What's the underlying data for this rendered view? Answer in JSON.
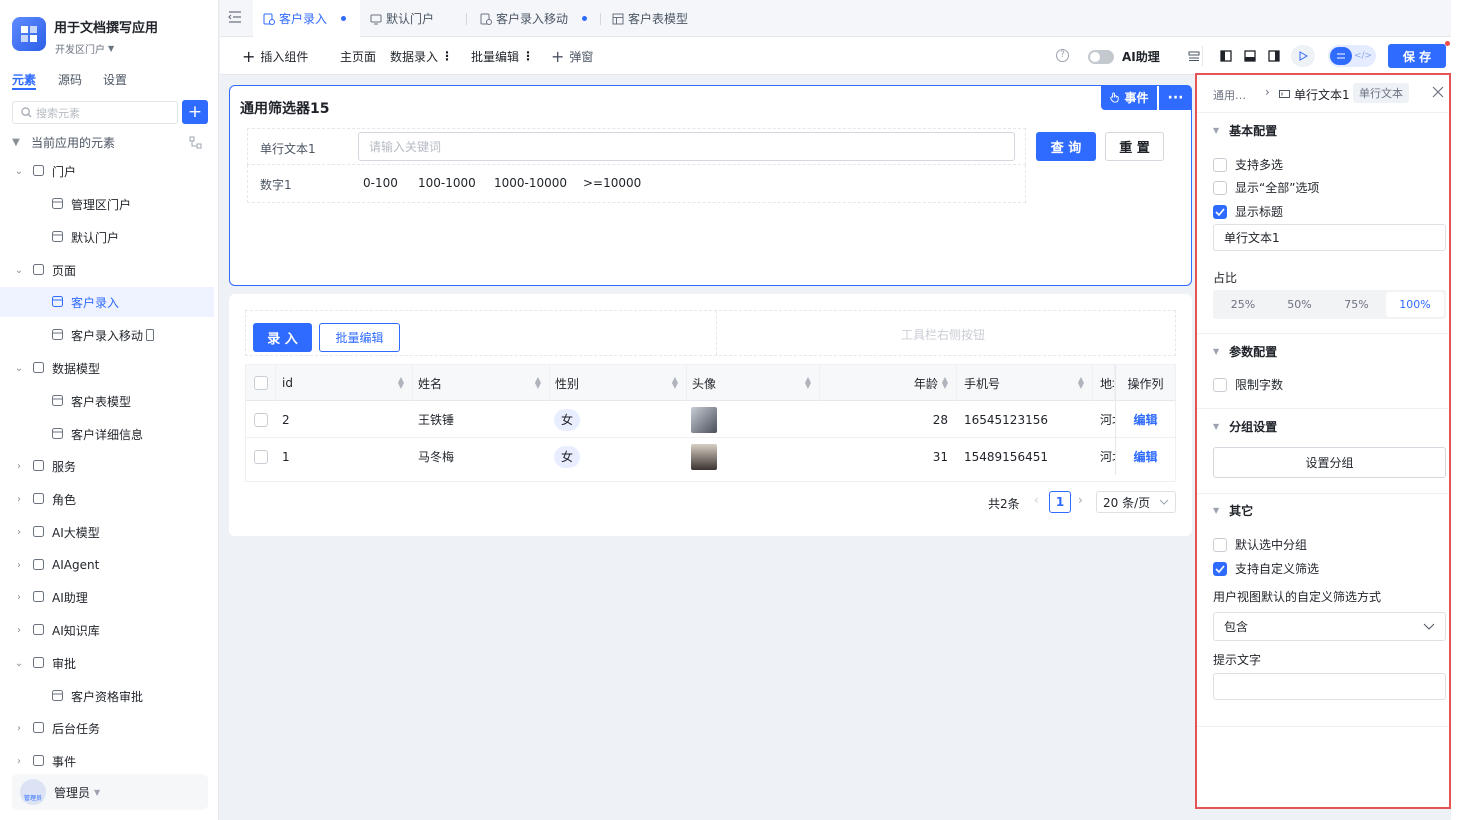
{
  "app": {
    "title": "用于文档撰写应用",
    "portal": "开发区门户"
  },
  "sidebar": {
    "tabs": [
      "元素",
      "源码",
      "设置"
    ],
    "search_placeholder": "搜索元素",
    "section": "当前应用的元素",
    "items": [
      {
        "label": "门户",
        "icon": "home-icon"
      },
      {
        "label": "管理区门户",
        "icon": "monitor-icon"
      },
      {
        "label": "默认门户",
        "icon": "monitor-icon"
      },
      {
        "label": "页面",
        "icon": "page-icon"
      },
      {
        "label": "客户录入",
        "icon": "page-globe-icon"
      },
      {
        "label": "客户录入移动",
        "icon": "page-globe-icon"
      },
      {
        "label": "数据模型",
        "icon": "table-icon"
      },
      {
        "label": "客户表模型",
        "icon": "table-icon"
      },
      {
        "label": "客户详细信息",
        "icon": "table-icon"
      },
      {
        "label": "服务",
        "icon": "service-icon"
      },
      {
        "label": "角色",
        "icon": "role-icon"
      },
      {
        "label": "AI大模型",
        "icon": "cube-icon"
      },
      {
        "label": "AIAgent",
        "icon": "robot-icon"
      },
      {
        "label": "AI助理",
        "icon": "ai-icon"
      },
      {
        "label": "AI知识库",
        "icon": "book-icon"
      },
      {
        "label": "审批",
        "icon": "stamp-icon"
      },
      {
        "label": "客户资格审批",
        "icon": "stamp-icon"
      },
      {
        "label": "后台任务",
        "icon": "task-icon"
      },
      {
        "label": "事件",
        "icon": "event-icon"
      }
    ],
    "user": "管理员",
    "avatar_text": "管理员"
  },
  "tabs": [
    "客户录入",
    "默认门户",
    "客户录入移动",
    "客户表模型"
  ],
  "toolbar": {
    "insert": "插入组件",
    "home": "主页面",
    "data_entry": "数据录入",
    "batch_edit": "批量编辑",
    "popup": "弹窗",
    "ai_assist": "AI助理",
    "save": "保 存"
  },
  "filter": {
    "title": "通用筛选器15",
    "event_btn": "事件",
    "text_label": "单行文本1",
    "text_placeholder": "请输入关键词",
    "query": "查 询",
    "reset": "重 置",
    "num_label": "数字1",
    "num_options": [
      "0-100",
      "100-1000",
      "1000-10000",
      ">=10000"
    ]
  },
  "table": {
    "enter_btn": "录 入",
    "batch_btn": "批量编辑",
    "right_toolbar": "工具栏右侧按钮",
    "columns": [
      "id",
      "姓名",
      "性别",
      "头像",
      "年龄",
      "手机号",
      "地址",
      "操作列"
    ],
    "rows": [
      {
        "id": "2",
        "name": "王铁锤",
        "gender": "女",
        "age": "28",
        "phone": "16545123156",
        "addr": "河北",
        "op": "编辑"
      },
      {
        "id": "1",
        "name": "马冬梅",
        "gender": "女",
        "age": "31",
        "phone": "15489156451",
        "addr": "河北",
        "op": "编辑"
      }
    ],
    "total": "共2条",
    "page": "1",
    "page_size": "20 条/页"
  },
  "props": {
    "breadcrumb_parent": "通用…",
    "breadcrumb_current": "单行文本1",
    "type_badge": "单行文本",
    "basic": "基本配置",
    "multi": "支持多选",
    "show_all": "显示“全部”选项",
    "show_title": "显示标题",
    "title_value": "单行文本1",
    "ratio_label": "占比",
    "ratios": [
      "25%",
      "50%",
      "75%",
      "100%"
    ],
    "param": "参数配置",
    "limit": "限制字数",
    "group": "分组设置",
    "set_group": "设置分组",
    "other": "其它",
    "default_group": "默认选中分组",
    "custom_filter": "支持自定义筛选",
    "custom_mode_label": "用户视图默认的自定义筛选方式",
    "custom_mode": "包含",
    "hint_label": "提示文字"
  }
}
